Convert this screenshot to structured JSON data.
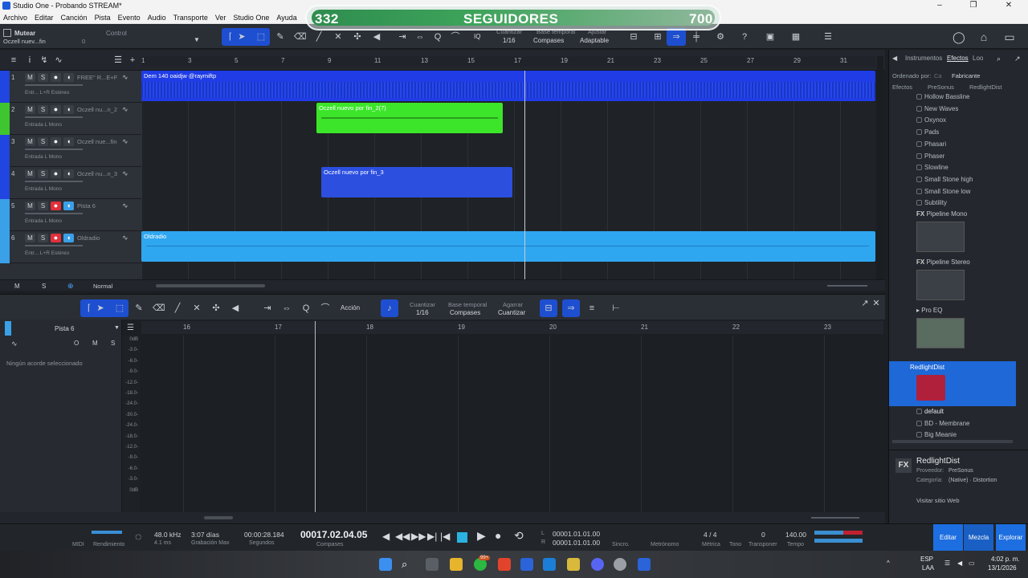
{
  "window": {
    "title": "Studio One - Probando STREAM*"
  },
  "menu": [
    "Archivo",
    "Editar",
    "Canción",
    "Pista",
    "Evento",
    "Audio",
    "Transporte",
    "Ver",
    "Studio One",
    "Ayuda"
  ],
  "banner": {
    "left": "332",
    "center": "SEGUIDORES",
    "right": "700"
  },
  "toolbar": {
    "mute_label": "Mutear",
    "mute_sub": "Oczell nuev...fin",
    "mute_value": "0",
    "control_label": "Control",
    "iq": "IQ",
    "quantize_label": "Cuantizar",
    "quantize_value": "1/16",
    "timebase_label": "Base temporal",
    "timebase_value": "Compases",
    "snap_label": "Ajustar",
    "snap_value": "Adaptable"
  },
  "ruler": [
    "1",
    "3",
    "5",
    "7",
    "9",
    "11",
    "13",
    "15",
    "17",
    "19",
    "21",
    "23",
    "25",
    "27",
    "29",
    "31"
  ],
  "tracks": [
    {
      "num": "1",
      "name": "FREE\" R...E+F",
      "input": "Entr... L+R Estéreo",
      "color": "#2145e0"
    },
    {
      "num": "2",
      "name": "Oczell nu...n_2",
      "input": "Entrada L Mono",
      "color": "#3fc52f"
    },
    {
      "num": "3",
      "name": "Oczell nue...fin",
      "input": "Entrada L Mono",
      "color": "#2145e0"
    },
    {
      "num": "4",
      "name": "Oczell nu...n_3",
      "input": "Entrada L Mono",
      "color": "#2145e0"
    },
    {
      "num": "5",
      "name": "Pista 6",
      "input": "Entrada L Mono",
      "color": "#3aa0e8"
    },
    {
      "num": "6",
      "name": "Oldradio",
      "input": "Entr... L+R Estéreo",
      "color": "#3aa0e8"
    }
  ],
  "track_buttons": {
    "m": "M",
    "s": "S"
  },
  "clips": {
    "clip1": "Dem 140 oaidjw @raymiftp",
    "clip2": "Oczell nuevo por fin_2(7)",
    "clip3": "Oczell nuevo por fin_3",
    "clip4": "Oldradio"
  },
  "arr_bottom": {
    "m": "M",
    "s": "S",
    "mode": "Normal"
  },
  "browser": {
    "tabs": [
      "Instrumentos",
      "Efectos",
      "Loo"
    ],
    "sort_label": "Ordenado por:",
    "sort_c": "Ca",
    "sort_value": "Fabricante",
    "path": [
      "Efectos",
      "PreSonus",
      "RedlightDist"
    ],
    "items_top": [
      "Hollow Bassline",
      "New Waves",
      "Oxynox",
      "Pads",
      "Phasari",
      "Phaser",
      "Slowline",
      "Small Stone high",
      "Small Stone low",
      "Subtility"
    ],
    "fx1": "Pipeline Mono",
    "fx2": "Pipeline Stereo",
    "fx3": "Pro EQ",
    "fx4": "RedlightDist",
    "presets": [
      "default",
      "BD - Membrane",
      "Big Meanie"
    ],
    "info_title": "RedlightDist",
    "info_vendor_label": "Proveedor:",
    "info_vendor": "PreSonus",
    "info_cat_label": "Categoría:",
    "info_cat": "(Native) · Distortion",
    "info_link": "Visitar sitio Web",
    "fx_badge": "FX"
  },
  "editor": {
    "action": "Acción",
    "quantize_label": "Cuantizar",
    "quantize_value": "1/16",
    "timebase_label": "Base temporal",
    "timebase_value": "Compases",
    "snap_label": "Agarrar",
    "snap_value": "Cuantizar",
    "track_name": "Pista 6",
    "no_chord": "Ningún acorde seleccionado",
    "btn_o": "O",
    "btn_m": "M",
    "btn_s": "S",
    "ruler": [
      "16",
      "17",
      "18",
      "19",
      "20",
      "21",
      "22",
      "23"
    ],
    "scale": [
      "0dB",
      "-3.0-",
      "-6.0-",
      "-9.0-",
      "-12.0-",
      "-18.0-",
      "-24.0-",
      "-30.0-",
      "-24.0-",
      "-18.0-",
      "-12.0-",
      "-9.0-",
      "-6.0-",
      "-3.0-",
      "0dB"
    ]
  },
  "transport": {
    "midi": "MIDI",
    "perf": "Rendimiento",
    "samplerate": "48.0 kHz",
    "latency": "4.1 ms",
    "rec_time": "3:07 días",
    "rec_label": "Grabación Max",
    "seconds": "00:00:28.184",
    "seconds_label": "Segundos",
    "bars": "00017.02.04.05",
    "bars_label": "Compases",
    "loop_l": "00001.01.01.00",
    "loop_r": "00001.01.01.00",
    "l": "L",
    "r": "R",
    "sync": "Sincro.",
    "metronome": "Metrónomo",
    "sig": "4 / 4",
    "sig_label": "Métrica",
    "tono_label": "Tono",
    "transpose": "0",
    "transpose_label": "Transponer",
    "tempo": "140.00",
    "tempo_label": "Tempo",
    "editar": "Editar",
    "mezcla": "Mezcla",
    "explorar": "Explorar"
  },
  "taskbar": {
    "lang": "ESP",
    "lang2": "LAA",
    "time": "4:02 p. m.",
    "date": "13/1/2026",
    "badge": "99+"
  }
}
